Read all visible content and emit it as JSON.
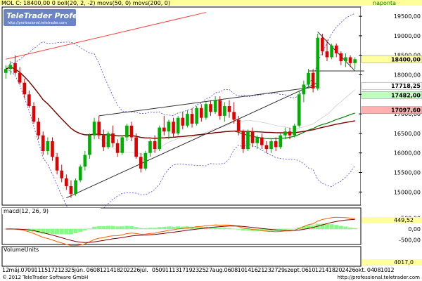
{
  "header": {
    "symbol_line": "MOL  C: 18400,00  0  boll(20, 2, -2)  movs(50, 0)  movs(200, 0)",
    "period": "naponta"
  },
  "watermark": {
    "title": "TeleTrader Professional",
    "url": "http://professional.teletrader.com"
  },
  "footer": {
    "copyright": "© 2012 TeleTrader Software GmbH",
    "url": "http://professional.teletrader.com"
  },
  "colors": {
    "header_bg": "#ffff99",
    "up_candle": "#00b000",
    "down_candle": "#e00000",
    "ma50": "#008000",
    "ma200": "#800000",
    "bollinger": "#4040ff",
    "trendline": "#303030",
    "red_trendline": "#ff4040",
    "macd": "#ff6000",
    "signal": "#800000",
    "hist": "#80ff80"
  },
  "price_axis": {
    "ticks": [
      "15000,00",
      "15500,00",
      "16000,00",
      "16500,00",
      "17000,00",
      "17500,00",
      "18000,00",
      "18500,00",
      "19000,00",
      "19500,00"
    ],
    "min": 14700,
    "max": 19700,
    "markers": [
      {
        "label": "18400,00",
        "value": 18400,
        "bg": "#ffffa0"
      },
      {
        "label": "17718,25",
        "value": 17718,
        "bg": "#ffffff"
      },
      {
        "label": "17482,00",
        "value": 17482,
        "bg": "#c0ffc0"
      },
      {
        "label": "17097,60",
        "value": 17097,
        "bg": "#ffb0b0"
      }
    ]
  },
  "macd_panel": {
    "label": "macd(12, 26, 9)",
    "ticks": [
      "500,00",
      "0,00",
      "-500,00"
    ],
    "min": -650,
    "max": 650,
    "marker": "449,52"
  },
  "volume_panel": {
    "label": "VolumeUnits",
    "marker": "4017,0"
  },
  "x_axis": {
    "labels": [
      "12",
      "máj.",
      "07",
      "09",
      "11",
      "15",
      "17",
      "21",
      "23",
      "25",
      "jún.",
      "06",
      "08",
      "12",
      "14",
      "18",
      "20",
      "22",
      "26",
      "júl.",
      "05",
      "09",
      "11",
      "13",
      "17",
      "19",
      "23",
      "25",
      "27",
      "aug.",
      "06",
      "08",
      "10",
      "14",
      "16",
      "21",
      "23",
      "27",
      "29",
      "szept.",
      "06",
      "10",
      "12",
      "14",
      "18",
      "20",
      "24",
      "26",
      "okt.",
      "04",
      "08",
      "10",
      "12"
    ]
  },
  "chart_data": {
    "type": "candlestick",
    "title": "MOL",
    "xlabel": "",
    "ylabel": "",
    "ylim": [
      14700,
      19700
    ],
    "grid": false,
    "last_close": 18400,
    "candles": [
      {
        "o": 18050,
        "h": 18250,
        "l": 17900,
        "c": 18150
      },
      {
        "o": 18150,
        "h": 18350,
        "l": 18000,
        "c": 18250
      },
      {
        "o": 18300,
        "h": 18500,
        "l": 18000,
        "c": 18050
      },
      {
        "o": 18050,
        "h": 18200,
        "l": 17750,
        "c": 17800
      },
      {
        "o": 17800,
        "h": 17900,
        "l": 17400,
        "c": 17500
      },
      {
        "o": 17500,
        "h": 17600,
        "l": 17150,
        "c": 17200
      },
      {
        "o": 17200,
        "h": 17300,
        "l": 16750,
        "c": 16800
      },
      {
        "o": 16800,
        "h": 16900,
        "l": 16350,
        "c": 16450
      },
      {
        "o": 16450,
        "h": 16550,
        "l": 15950,
        "c": 16050
      },
      {
        "o": 16050,
        "h": 16400,
        "l": 15950,
        "c": 16300
      },
      {
        "o": 16300,
        "h": 16400,
        "l": 15800,
        "c": 15900
      },
      {
        "o": 15900,
        "h": 16000,
        "l": 15450,
        "c": 15550
      },
      {
        "o": 15550,
        "h": 15700,
        "l": 15250,
        "c": 15350
      },
      {
        "o": 15350,
        "h": 15450,
        "l": 15050,
        "c": 15150
      },
      {
        "o": 15150,
        "h": 15300,
        "l": 14850,
        "c": 14950
      },
      {
        "o": 14950,
        "h": 15350,
        "l": 14900,
        "c": 15300
      },
      {
        "o": 15300,
        "h": 15700,
        "l": 15250,
        "c": 15650
      },
      {
        "o": 15650,
        "h": 16050,
        "l": 15550,
        "c": 15950
      },
      {
        "o": 15950,
        "h": 16500,
        "l": 15850,
        "c": 16450
      },
      {
        "o": 16450,
        "h": 16900,
        "l": 16350,
        "c": 16800
      },
      {
        "o": 16800,
        "h": 16950,
        "l": 16350,
        "c": 16450
      },
      {
        "o": 16450,
        "h": 16600,
        "l": 16050,
        "c": 16150
      },
      {
        "o": 16150,
        "h": 16550,
        "l": 16100,
        "c": 16500
      },
      {
        "o": 16500,
        "h": 16700,
        "l": 16150,
        "c": 16250
      },
      {
        "o": 16250,
        "h": 16350,
        "l": 15900,
        "c": 16000
      },
      {
        "o": 16000,
        "h": 16450,
        "l": 15950,
        "c": 16400
      },
      {
        "o": 16400,
        "h": 16750,
        "l": 16300,
        "c": 16700
      },
      {
        "o": 16700,
        "h": 16800,
        "l": 16300,
        "c": 16400
      },
      {
        "o": 16400,
        "h": 16500,
        "l": 15850,
        "c": 15900
      },
      {
        "o": 15900,
        "h": 16000,
        "l": 15500,
        "c": 15600
      },
      {
        "o": 15600,
        "h": 16050,
        "l": 15550,
        "c": 16000
      },
      {
        "o": 16000,
        "h": 16350,
        "l": 15900,
        "c": 16300
      },
      {
        "o": 16300,
        "h": 16450,
        "l": 16000,
        "c": 16100
      },
      {
        "o": 16100,
        "h": 16700,
        "l": 16050,
        "c": 16650
      },
      {
        "o": 16650,
        "h": 16950,
        "l": 16450,
        "c": 16550
      },
      {
        "o": 16550,
        "h": 16850,
        "l": 16350,
        "c": 16800
      },
      {
        "o": 16800,
        "h": 16900,
        "l": 16400,
        "c": 16500
      },
      {
        "o": 16500,
        "h": 16950,
        "l": 16450,
        "c": 16900
      },
      {
        "o": 16900,
        "h": 17050,
        "l": 16600,
        "c": 16700
      },
      {
        "o": 16700,
        "h": 17100,
        "l": 16650,
        "c": 17000
      },
      {
        "o": 17000,
        "h": 17150,
        "l": 16650,
        "c": 16750
      },
      {
        "o": 16750,
        "h": 17200,
        "l": 16700,
        "c": 17150
      },
      {
        "o": 17150,
        "h": 17250,
        "l": 16800,
        "c": 16900
      },
      {
        "o": 16900,
        "h": 17300,
        "l": 16850,
        "c": 17250
      },
      {
        "o": 17250,
        "h": 17350,
        "l": 16950,
        "c": 17050
      },
      {
        "o": 17050,
        "h": 17450,
        "l": 17000,
        "c": 17350
      },
      {
        "o": 17350,
        "h": 17450,
        "l": 16850,
        "c": 16950
      },
      {
        "o": 16950,
        "h": 17300,
        "l": 16800,
        "c": 17200
      },
      {
        "o": 17200,
        "h": 17350,
        "l": 16900,
        "c": 17050
      },
      {
        "o": 17050,
        "h": 17300,
        "l": 16750,
        "c": 16850
      },
      {
        "o": 16850,
        "h": 16950,
        "l": 16450,
        "c": 16550
      },
      {
        "o": 16550,
        "h": 16600,
        "l": 16000,
        "c": 16100
      },
      {
        "o": 16100,
        "h": 16600,
        "l": 16050,
        "c": 16550
      },
      {
        "o": 16550,
        "h": 16650,
        "l": 16150,
        "c": 16250
      },
      {
        "o": 16250,
        "h": 16450,
        "l": 16100,
        "c": 16400
      },
      {
        "o": 16400,
        "h": 16500,
        "l": 16100,
        "c": 16200
      },
      {
        "o": 16200,
        "h": 16300,
        "l": 16000,
        "c": 16100
      },
      {
        "o": 16100,
        "h": 16350,
        "l": 16000,
        "c": 16300
      },
      {
        "o": 16300,
        "h": 16400,
        "l": 16050,
        "c": 16150
      },
      {
        "o": 16150,
        "h": 16500,
        "l": 16100,
        "c": 16450
      },
      {
        "o": 16450,
        "h": 16650,
        "l": 16350,
        "c": 16550
      },
      {
        "o": 16550,
        "h": 16650,
        "l": 16350,
        "c": 16450
      },
      {
        "o": 16450,
        "h": 16750,
        "l": 16400,
        "c": 16700
      },
      {
        "o": 16700,
        "h": 17600,
        "l": 16650,
        "c": 17500
      },
      {
        "o": 17500,
        "h": 17850,
        "l": 17300,
        "c": 17750
      },
      {
        "o": 17750,
        "h": 18150,
        "l": 17650,
        "c": 18050
      },
      {
        "o": 18050,
        "h": 18150,
        "l": 17550,
        "c": 17650
      },
      {
        "o": 17650,
        "h": 19050,
        "l": 17600,
        "c": 18950
      },
      {
        "o": 18950,
        "h": 19050,
        "l": 18500,
        "c": 18600
      },
      {
        "o": 18600,
        "h": 18900,
        "l": 18350,
        "c": 18450
      },
      {
        "o": 18450,
        "h": 18800,
        "l": 18400,
        "c": 18750
      },
      {
        "o": 18750,
        "h": 18800,
        "l": 18450,
        "c": 18550
      },
      {
        "o": 18550,
        "h": 18600,
        "l": 18250,
        "c": 18350
      },
      {
        "o": 18350,
        "h": 18550,
        "l": 18200,
        "c": 18450
      },
      {
        "o": 18450,
        "h": 18500,
        "l": 18200,
        "c": 18300
      },
      {
        "o": 18300,
        "h": 18450,
        "l": 18150,
        "c": 18400
      }
    ]
  }
}
